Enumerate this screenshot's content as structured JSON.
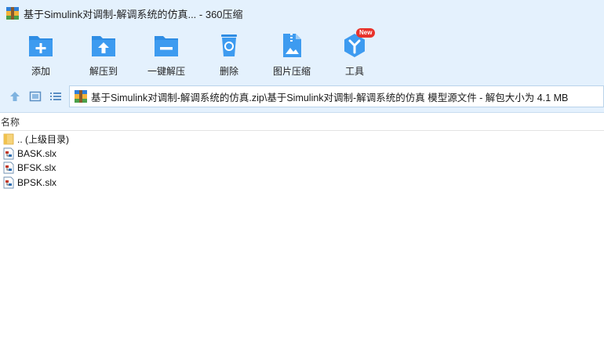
{
  "window": {
    "title": "基于Simulink对调制-解调系统的仿真... - 360压缩"
  },
  "toolbar": {
    "items": [
      {
        "label": "添加",
        "icon": "add-folder-icon"
      },
      {
        "label": "解压到",
        "icon": "extract-to-icon"
      },
      {
        "label": "一键解压",
        "icon": "one-click-extract-icon"
      },
      {
        "label": "删除",
        "icon": "trash-icon"
      },
      {
        "label": "图片压缩",
        "icon": "image-compress-icon"
      },
      {
        "label": "工具",
        "icon": "tools-icon",
        "badge": "New"
      }
    ]
  },
  "address": {
    "path": "基于Simulink对调制-解调系统的仿真.zip\\基于Simulink对调制-解调系统的仿真 模型源文件 - 解包大小为 4.1 MB"
  },
  "columns": {
    "name": "名称"
  },
  "files": [
    {
      "name": ".. (上级目录)",
      "icon": "parent-folder-icon"
    },
    {
      "name": "BASK.slx",
      "icon": "slx-file-icon"
    },
    {
      "name": "BFSK.slx",
      "icon": "slx-file-icon"
    },
    {
      "name": "BPSK.slx",
      "icon": "slx-file-icon"
    }
  ],
  "colors": {
    "accent": "#2f8de4",
    "toolbar_bg": "#e4f1fd",
    "badge": "#e8322b"
  }
}
